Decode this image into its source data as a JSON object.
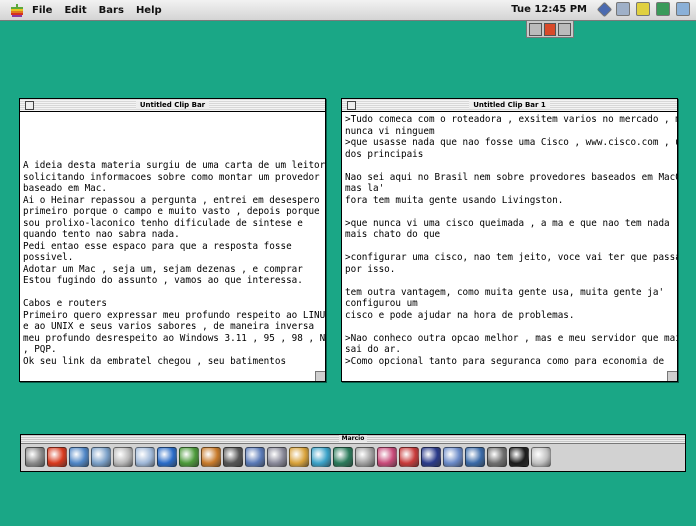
{
  "menubar": {
    "items": [
      "File",
      "Edit",
      "Bars",
      "Help"
    ],
    "clock": "Tue 12:45 PM"
  },
  "window_left": {
    "title": "Untitled Clip Bar",
    "lines": [
      "",
      "",
      "",
      "",
      "A ideia desta materia surgiu de uma carta de um leitor",
      "solicitando informacoes sobre como montar um provedor",
      "baseado em Mac.",
      "Ai o Heinar repassou a pergunta , entrei em desespero ,",
      "primeiro porque o campo e muito vasto , depois porque",
      "sou prolixo-laconico tenho dificulade de sintese e",
      "quando tento nao sabra nada.",
      "Pedi entao esse espaco para que a resposta fosse",
      "possivel.",
      "Adotar um Mac , seja um, sejam dezenas , e comprar",
      "Estou fugindo do assunto , vamos ao que interessa.",
      "",
      "Cabos e routers",
      "Primeiro quero expressar meu profundo respeito ao LINUX",
      "e ao UNIX e seus varios sabores , de maneira inversa",
      "meu profundo desrespeito ao Windows 3.11 , 95 , 98 , NT",
      ", PQP.",
      "Ok seu link da embratel chegou , seu batimentos"
    ]
  },
  "window_right": {
    "title": "Untitled Clip Bar 1",
    "lines": [
      ">Tudo comeca com o roteadora , exsitem varios no mercado , mas",
      "nunca vi ninguem",
      ">que usasse nada que nao fosse uma Cisco , www.cisco.com , um",
      "dos principais",
      "",
      "Nao sei aqui no Brasil nem sobre provedores baseados em MacOS,",
      "mas la'",
      "fora tem muita gente usando Livingston.",
      "",
      ">que nunca vi uma cisco queimada , a ma e que nao tem nada",
      "mais chato do que",
      "",
      ">configurar uma cisco, nao tem jeito, voce vai ter que passar",
      "por isso.",
      "",
      "tem outra vantagem, como muita gente usa, muita gente ja'",
      "configurou um",
      "cisco e pode ajudar na hora de problemas.",
      "",
      ">Nao conheco outra opcao melhor , mas e meu servidor que mais",
      "sai do ar.",
      ">Como opcional tanto para seguranca como para economia de"
    ]
  },
  "launcher": {
    "title": "Marcio",
    "icons": [
      {
        "name": "network-icon",
        "color": "#8a8a8a"
      },
      {
        "name": "opera-icon",
        "color": "#d83a1e"
      },
      {
        "name": "photo-icon",
        "color": "#4f86c6"
      },
      {
        "name": "finder-icon",
        "color": "#7aa0c8"
      },
      {
        "name": "calculator-icon",
        "color": "#b8b8b8"
      },
      {
        "name": "editor-icon",
        "color": "#9fb8d8"
      },
      {
        "name": "internet-explorer-icon",
        "color": "#2a6cc8"
      },
      {
        "name": "frog-icon",
        "color": "#4c9a3a"
      },
      {
        "name": "graphic-icon",
        "color": "#c87a2a"
      },
      {
        "name": "monitor-icon",
        "color": "#555555"
      },
      {
        "name": "folder-icon",
        "color": "#5a7ab8"
      },
      {
        "name": "stack-icon",
        "color": "#8a8a9a"
      },
      {
        "name": "paint-icon",
        "color": "#d8a23a"
      },
      {
        "name": "pictures-icon",
        "color": "#3aa2c8"
      },
      {
        "name": "game-icon",
        "color": "#2a7a5a"
      },
      {
        "name": "drive-icon",
        "color": "#a0a0a0"
      },
      {
        "name": "image-edit-icon",
        "color": "#c84a7a"
      },
      {
        "name": "document-icon",
        "color": "#c83a3a"
      },
      {
        "name": "netscape-icon",
        "color": "#2a3a8a"
      },
      {
        "name": "macos-icon",
        "color": "#6a8ac8"
      },
      {
        "name": "cube-icon",
        "color": "#3a6aa8"
      },
      {
        "name": "toolbox-icon",
        "color": "#707070"
      },
      {
        "name": "screen-icon",
        "color": "#1c1c1c"
      },
      {
        "name": "empty-slot-icon",
        "color": "#c0c0c0"
      }
    ]
  }
}
